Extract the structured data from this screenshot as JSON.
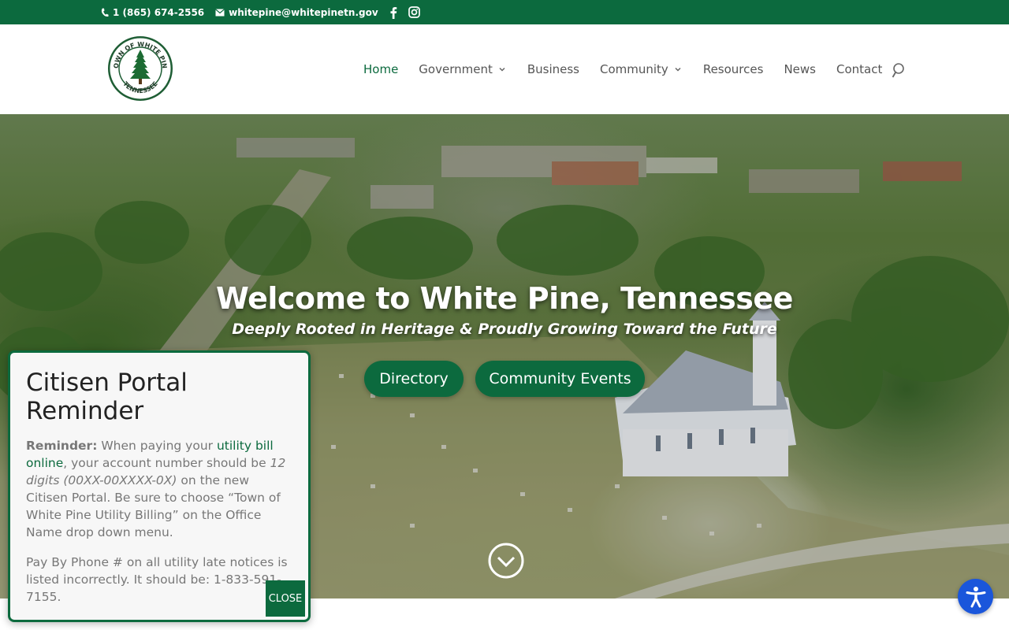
{
  "topbar": {
    "phone": "1 (865) 674-2556",
    "email": "whitepine@whitepinetn.gov",
    "social": [
      "facebook-icon",
      "instagram-icon"
    ]
  },
  "header": {
    "logo_text": "TOWN OF WHITE PINE TENNESSEE",
    "nav": [
      {
        "label": "Home",
        "active": true,
        "dropdown": false
      },
      {
        "label": "Government",
        "active": false,
        "dropdown": true
      },
      {
        "label": "Business",
        "active": false,
        "dropdown": false
      },
      {
        "label": "Community",
        "active": false,
        "dropdown": true
      },
      {
        "label": "Resources",
        "active": false,
        "dropdown": false
      },
      {
        "label": "News",
        "active": false,
        "dropdown": false
      },
      {
        "label": "Contact",
        "active": false,
        "dropdown": false
      }
    ]
  },
  "hero": {
    "title": "Welcome to White Pine, Tennessee",
    "subtitle": "Deeply Rooted in Heritage & Proudly Growing Toward the Future",
    "buttons": {
      "directory": "Directory",
      "events": "Community Events"
    }
  },
  "popup": {
    "title": "Citisen Portal Reminder",
    "reminder_label": "Reminder:",
    "text_1": " When paying your ",
    "link_text": "utility bill online",
    "text_2": ", your account number should be ",
    "digits": "12 digits (00XX-00XXXX-0X)",
    "text_3": " on the new Citisen Portal. Be sure to choose “Town of White Pine Utility Billing” on the Office Name drop down menu.",
    "paragraph_2": "Pay By Phone # on all utility late notices is listed incorrectly. It should be: 1-833-591-7155.",
    "close_label": "CLOSE"
  },
  "colors": {
    "brand_green": "#0c6a3e",
    "accessibility_blue": "#1a56db"
  }
}
